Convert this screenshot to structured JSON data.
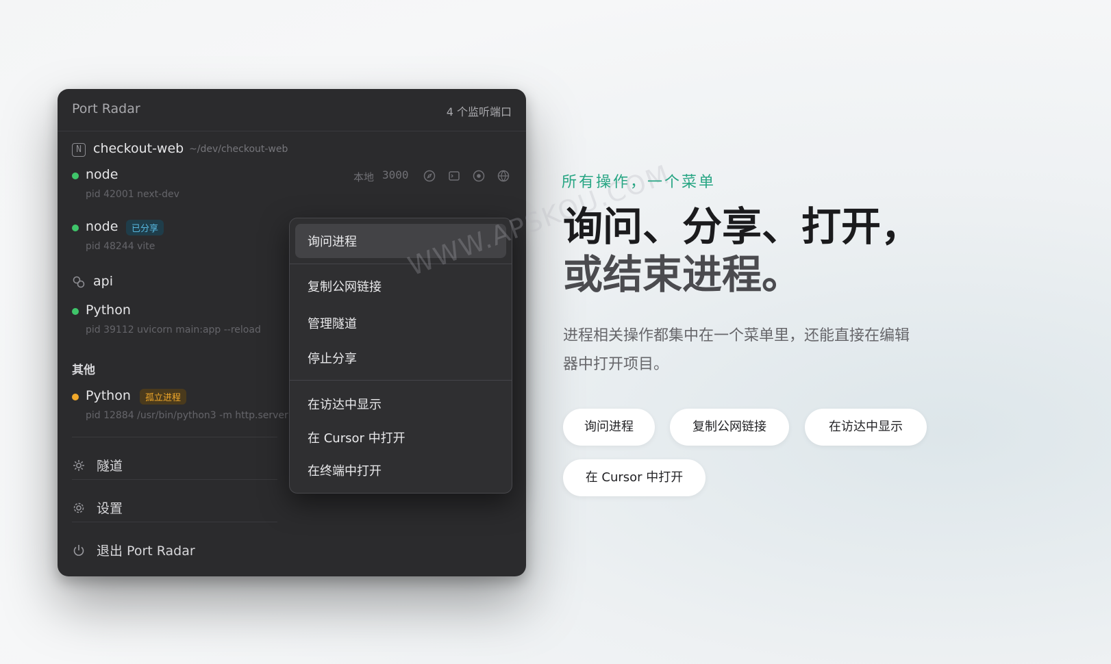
{
  "window": {
    "title": "Port Radar",
    "port_count": "4 个监听端口",
    "project": {
      "icon": "N",
      "name": "checkout-web",
      "path": "~/dev/checkout-web"
    },
    "processes": [
      {
        "name": "node",
        "status": "green",
        "meta": "pid 42001  next-dev",
        "local_label": "本地",
        "port": "3000"
      },
      {
        "name": "node",
        "status": "green",
        "badge": "已分享",
        "meta": "pid 48244  vite"
      },
      {
        "name": "api",
        "icon": "link-icon"
      },
      {
        "name": "Python",
        "status": "green",
        "meta": "pid 39112  uvicorn main:app --reload"
      }
    ],
    "other_section": {
      "label": "其他",
      "processes": [
        {
          "name": "Python",
          "status": "orange",
          "badge": "孤立进程",
          "meta": "pid 12884  /usr/bin/python3 -m http.server"
        }
      ]
    },
    "footer_menu": [
      {
        "label": "隧道",
        "icon": "tunnel-icon"
      },
      {
        "label": "设置",
        "icon": "gear-icon"
      },
      {
        "label": "退出 Port Radar",
        "icon": "power-icon"
      }
    ],
    "context_menu": {
      "highlighted": "询问进程",
      "group2": [
        "复制公网链接",
        "管理隧道",
        "停止分享"
      ],
      "group3": [
        "在访达中显示",
        "在 Cursor 中打开",
        "在终端中打开"
      ]
    }
  },
  "watermark": "WWW.APSKOU.COM",
  "marketing": {
    "eyebrow": "所有操作，一个菜单",
    "headline_line1": "询问、分享、打开，",
    "headline_line2": "或结束进程。",
    "description": "进程相关操作都集中在一个菜单里，还能直接在编辑器中打开项目。",
    "pills": [
      "询问进程",
      "复制公网链接",
      "在访达中显示",
      "在 Cursor 中打开"
    ]
  },
  "colors": {
    "accent": "#27a583",
    "status_green": "#3fc56a",
    "status_orange": "#f0a82a"
  }
}
